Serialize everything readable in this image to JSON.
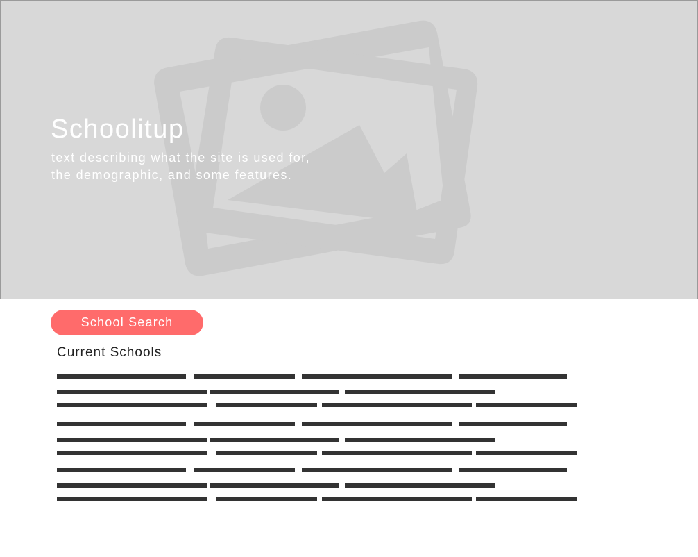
{
  "hero": {
    "title": "Schoolitup",
    "description_lines": [
      "text describing what the site is used for,",
      "the demographic, and some features."
    ],
    "background_color": "#d8d8d8",
    "image_icon": "image-placeholder-icon"
  },
  "search": {
    "button_label": "School Search",
    "button_color": "#ff6b6b"
  },
  "schools": {
    "heading": "Current Schools",
    "entries": [
      {
        "placeholder": "text-line-placeholder"
      },
      {
        "placeholder": "text-line-placeholder"
      },
      {
        "placeholder": "text-line-placeholder"
      }
    ]
  }
}
